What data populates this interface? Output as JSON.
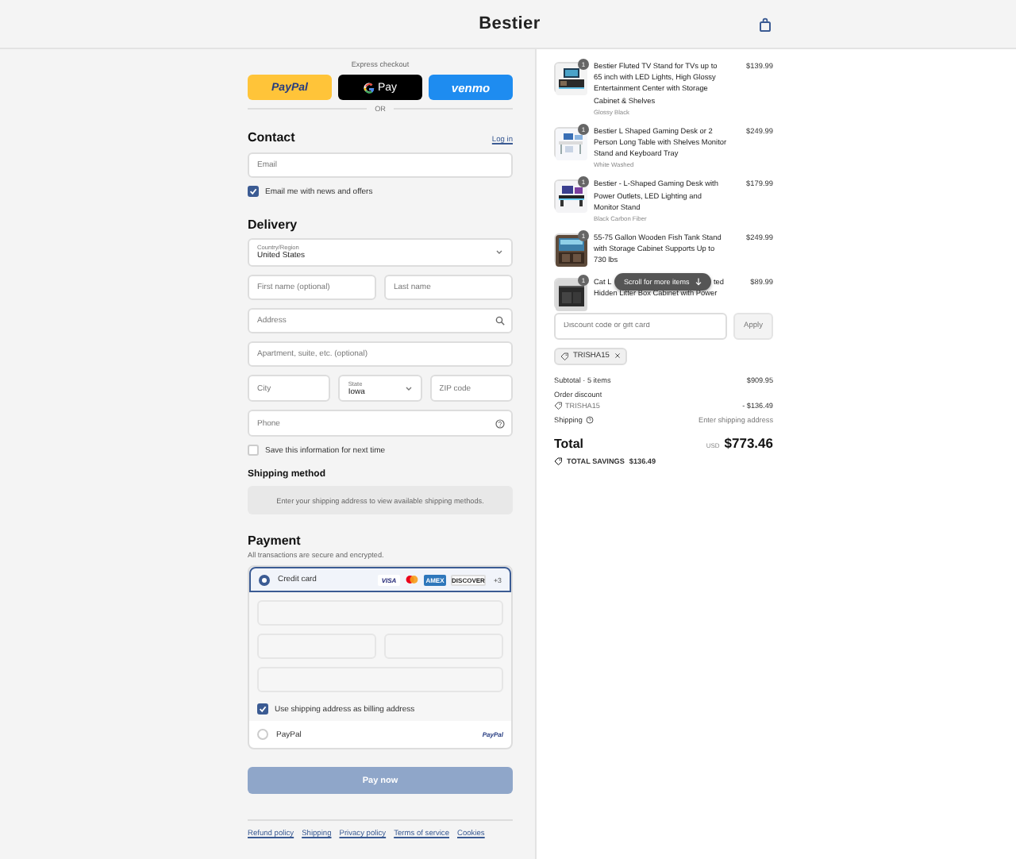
{
  "header": {
    "logo": "Bestier"
  },
  "express": {
    "label": "Express checkout",
    "buttons": [
      {
        "kind": "paypal",
        "label": "PayPal"
      },
      {
        "kind": "gpay",
        "label": "Pay"
      },
      {
        "kind": "venmo",
        "label": "venmo"
      }
    ],
    "divider": "OR"
  },
  "contact": {
    "title": "Contact",
    "login": "Log in",
    "email": {
      "placeholder": "Email"
    },
    "offers": {
      "label": "Email me with news and offers",
      "checked": true
    }
  },
  "delivery": {
    "title": "Delivery",
    "country": {
      "label": "Country/Region",
      "value": "United States"
    },
    "first_name": {
      "placeholder": "First name (optional)"
    },
    "last_name": {
      "placeholder": "Last name"
    },
    "address": {
      "placeholder": "Address"
    },
    "apartment": {
      "placeholder": "Apartment, suite, etc. (optional)"
    },
    "city": {
      "placeholder": "City"
    },
    "state": {
      "label": "State",
      "value": "Iowa"
    },
    "zip": {
      "placeholder": "ZIP code"
    },
    "phone": {
      "placeholder": "Phone"
    },
    "save_info": {
      "label": "Save this information for next time",
      "checked": false
    }
  },
  "shipping_method": {
    "title": "Shipping method",
    "notice": "Enter your shipping address to view available shipping methods."
  },
  "payment": {
    "title": "Payment",
    "subtitle": "All transactions are secure and encrypted.",
    "methods": [
      {
        "kind": "card",
        "label": "Credit card",
        "selected": true,
        "brands": [
          {
            "kind": "visa",
            "label": "VISA"
          },
          {
            "kind": "mastercard"
          },
          {
            "kind": "amex",
            "label": "AMEX"
          },
          {
            "kind": "discover",
            "label": "DISCOVER"
          },
          {
            "kind": "more",
            "label": "+3"
          }
        ],
        "billing": {
          "label": "Use shipping address as billing address",
          "checked": true
        }
      },
      {
        "kind": "paypal",
        "label": "PayPal",
        "selected": false,
        "logo": "PayPal"
      }
    ]
  },
  "pay_button": {
    "label": "Pay now",
    "disabled": true
  },
  "footer_links": [
    "Refund policy",
    "Shipping",
    "Privacy policy",
    "Terms of service",
    "Cookies"
  ],
  "cart": {
    "items": [
      {
        "quantity": "1",
        "title": "Bestier Fluted TV Stand for TVs up to 65 inch with LED Lights, High Glossy Entertainment Center with Storage Cabinet & Shelves",
        "variant": "Glossy Black",
        "price": "$139.99"
      },
      {
        "quantity": "1",
        "title": "Bestier L Shaped Gaming Desk or 2 Person Long Table with Shelves Monitor Stand and Keyboard Tray",
        "variant": "White Washed",
        "price": "$249.99"
      },
      {
        "quantity": "1",
        "title": "Bestier - L-Shaped Gaming Desk with Power Outlets, LED Lighting and Monitor Stand",
        "variant": "Black Carbon Fiber",
        "price": "$179.99"
      },
      {
        "quantity": "1",
        "title": "55-75 Gallon Wooden Fish Tank Stand with Storage Cabinet Supports Up to 730 lbs",
        "price": "$249.99"
      },
      {
        "quantity": "1",
        "title_start": "Cat L",
        "title_end": "ted",
        "title": "Hidden Litter Box Cabinet with Power",
        "price": "$89.99"
      }
    ],
    "scroll_hint": "Scroll for more items"
  },
  "discount": {
    "placeholder": "Discount code or gift card",
    "apply": "Apply",
    "applied_code": "TRISHA15"
  },
  "totals": {
    "subtotal_label": "Subtotal · 5 items",
    "subtotal": "$909.95",
    "discount_label": "Order discount",
    "discount_code": "TRISHA15",
    "discount_amount": "- $136.49",
    "shipping_label": "Shipping",
    "shipping_value": "Enter shipping address",
    "total_label": "Total",
    "currency": "USD",
    "total": "$773.46",
    "savings_label": "TOTAL SAVINGS",
    "savings": "$136.49"
  }
}
